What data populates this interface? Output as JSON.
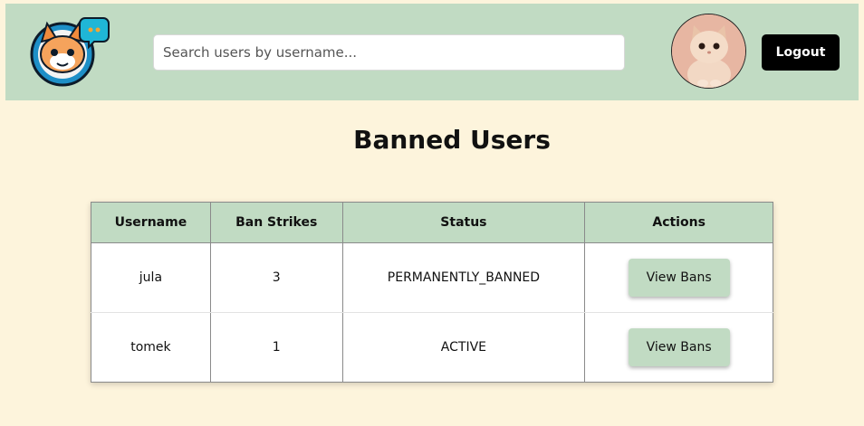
{
  "header": {
    "logo_icon": "cat-chat-logo-icon",
    "search": {
      "placeholder": "Search users by username...",
      "value": ""
    },
    "avatar_icon": "cat-avatar-icon",
    "logout_label": "Logout",
    "colors": {
      "header_bg": "#c1dbc3",
      "logout_bg": "#000000"
    }
  },
  "main": {
    "title": "Banned Users",
    "table": {
      "columns": [
        "Username",
        "Ban Strikes",
        "Status",
        "Actions"
      ],
      "rows": [
        {
          "username": "jula",
          "ban_strikes": "3",
          "status": "PERMANENTLY_BANNED",
          "action_label": "View Bans"
        },
        {
          "username": "tomek",
          "ban_strikes": "1",
          "status": "ACTIVE",
          "action_label": "View Bans"
        }
      ]
    }
  },
  "colors": {
    "page_bg": "#fdf4dc",
    "accent": "#c1dbc3"
  }
}
